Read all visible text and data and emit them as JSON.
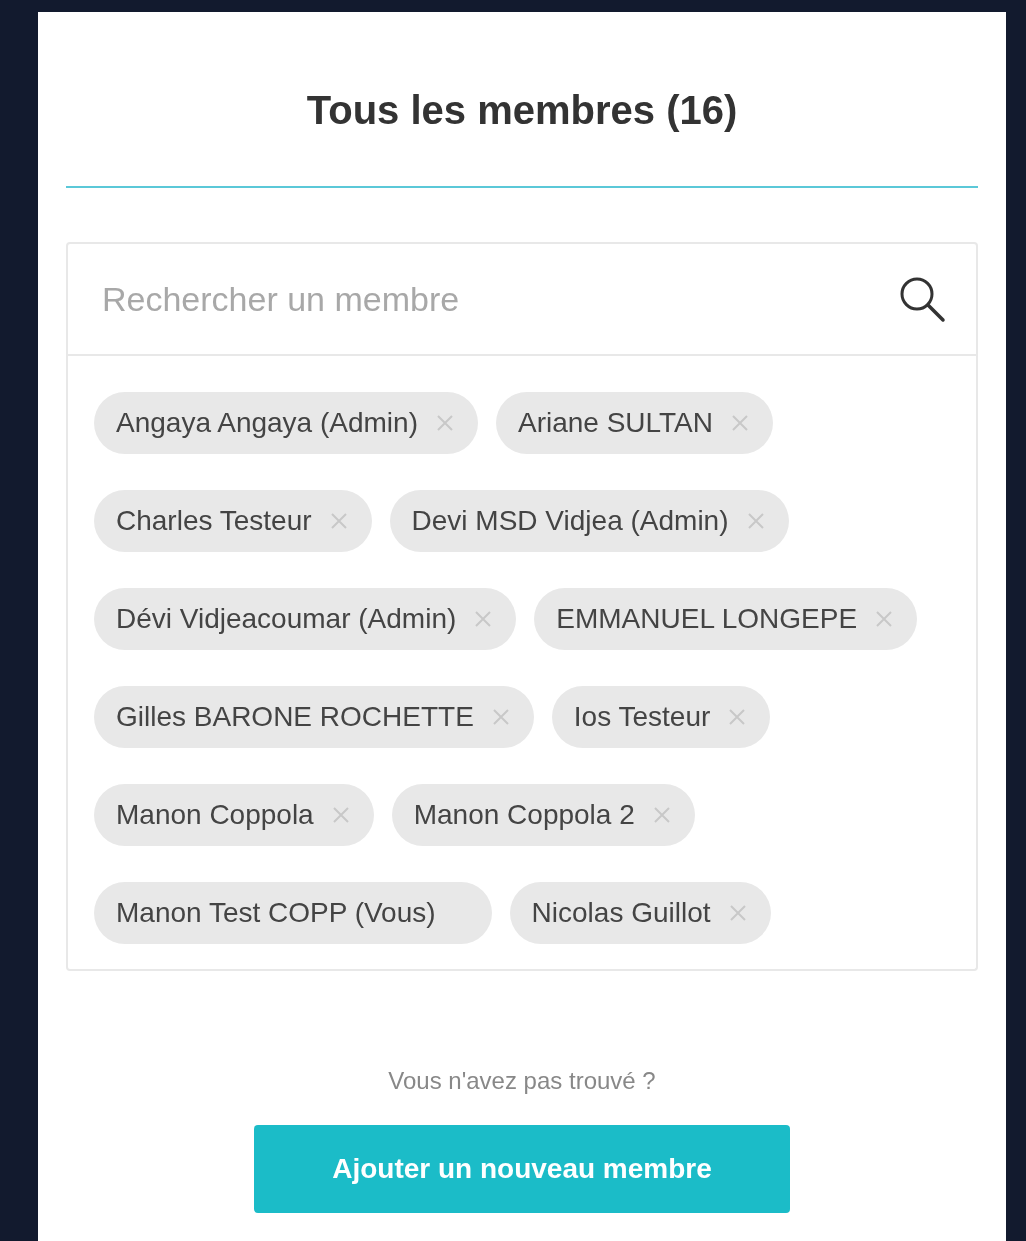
{
  "title": "Tous les membres (16)",
  "search": {
    "placeholder": "Rechercher un membre"
  },
  "members": [
    {
      "name": "Angaya Angaya (Admin)",
      "removable": true
    },
    {
      "name": "Ariane SULTAN",
      "removable": true
    },
    {
      "name": "Charles Testeur",
      "removable": true
    },
    {
      "name": "Devi MSD Vidjea (Admin)",
      "removable": true
    },
    {
      "name": "Dévi Vidjeacoumar (Admin)",
      "removable": true
    },
    {
      "name": "EMMANUEL LONGEPE",
      "removable": true
    },
    {
      "name": "Gilles BARONE ROCHETTE",
      "removable": true
    },
    {
      "name": "Ios Testeur",
      "removable": true
    },
    {
      "name": "Manon Coppola",
      "removable": true
    },
    {
      "name": "Manon Coppola 2",
      "removable": true
    },
    {
      "name": "Manon Test COPP (Vous)",
      "removable": false
    },
    {
      "name": "Nicolas Guillot",
      "removable": true
    }
  ],
  "not_found": "Vous n'avez pas trouvé ?",
  "add_button": "Ajouter un nouveau membre"
}
